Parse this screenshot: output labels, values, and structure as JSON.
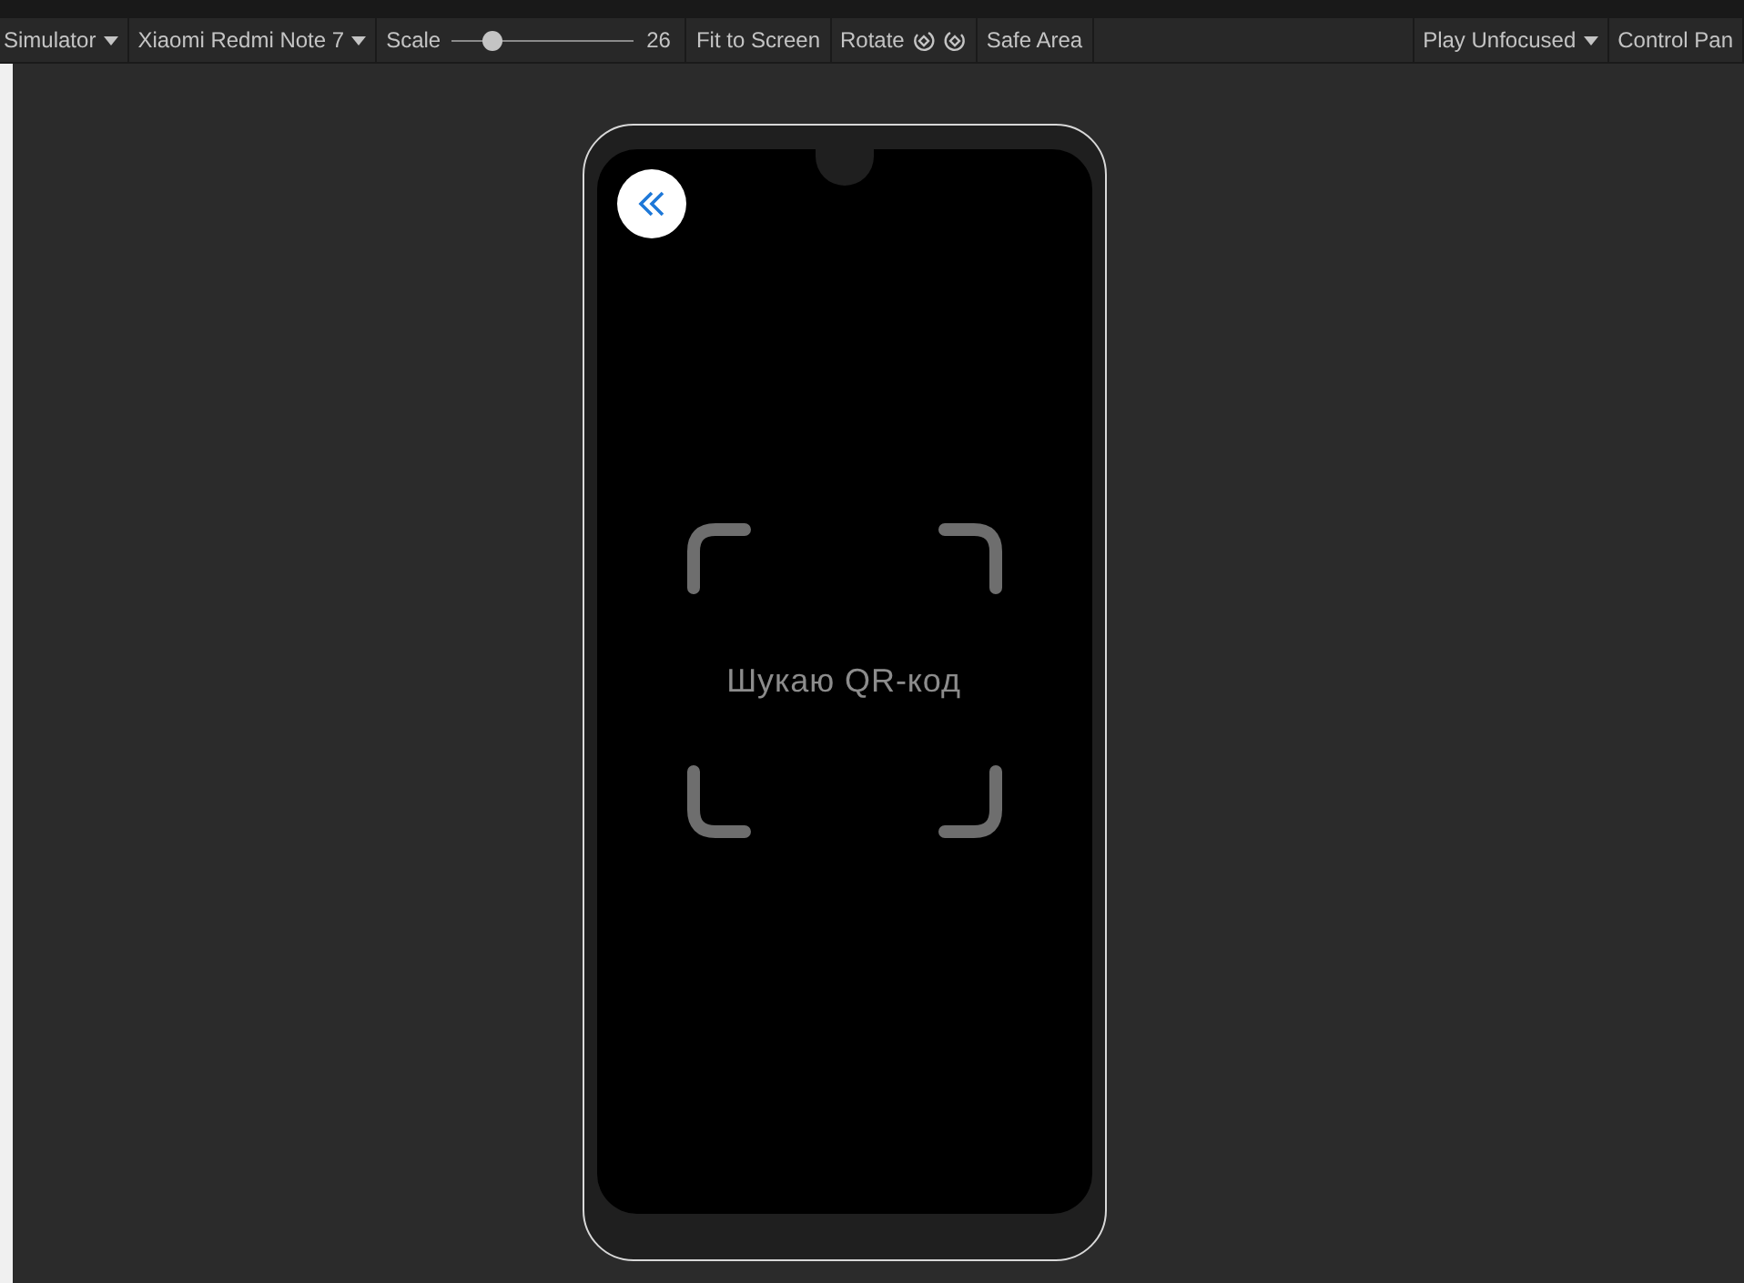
{
  "toolbar": {
    "left": [
      {
        "kind": "dropdown",
        "label": "Simulator"
      },
      {
        "kind": "dropdown",
        "label": "Xiaomi Redmi Note 7"
      },
      {
        "kind": "slider",
        "label": "Scale",
        "level": 0.22,
        "reading": "26"
      },
      {
        "kind": "button",
        "label": "Fit to Screen"
      },
      {
        "kind": "rotate",
        "label": "Rotate"
      },
      {
        "kind": "button",
        "label": "Safe Area"
      }
    ],
    "right": [
      {
        "kind": "dropdown",
        "label": "Play Unfocused"
      },
      {
        "kind": "button",
        "label": "Control Pan"
      }
    ]
  },
  "phone": {
    "status_text": "Шукаю QR-код"
  }
}
